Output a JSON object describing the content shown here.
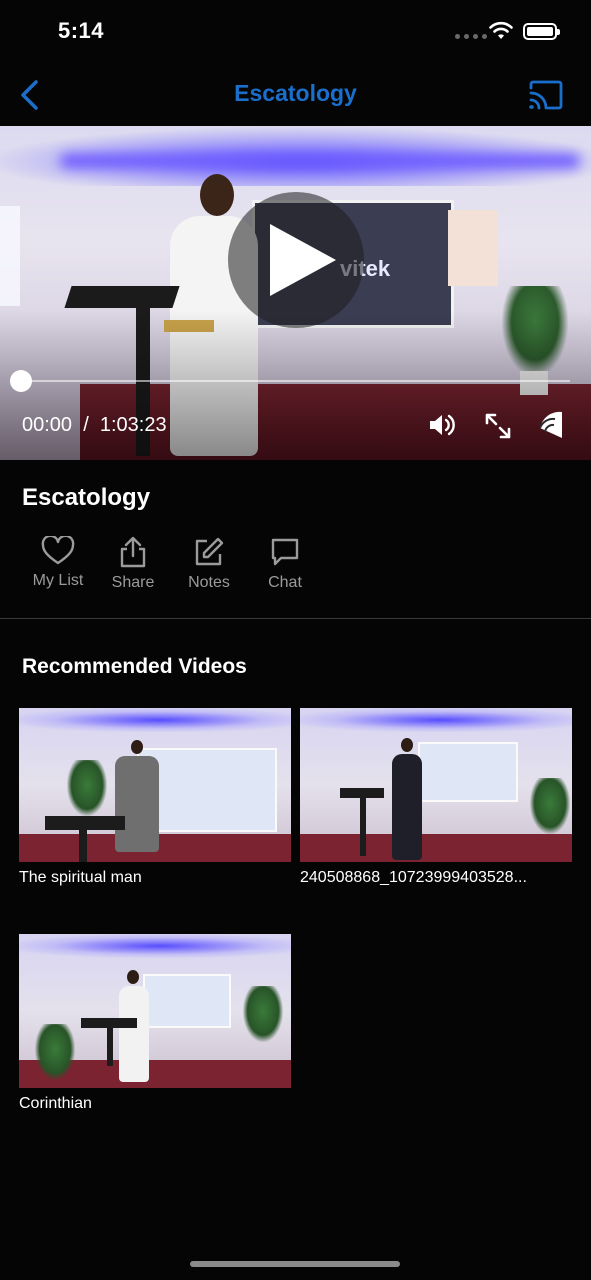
{
  "status_bar": {
    "time": "5:14"
  },
  "nav": {
    "title": "Escatology"
  },
  "player": {
    "current_time": "00:00",
    "separator": "/",
    "duration": "1:03:23",
    "progress": 0,
    "screen_text": "vitek"
  },
  "video": {
    "title": "Escatology"
  },
  "actions": [
    {
      "label": "My List",
      "icon": "heart-icon"
    },
    {
      "label": "Share",
      "icon": "share-icon"
    },
    {
      "label": "Notes",
      "icon": "edit-icon"
    },
    {
      "label": "Chat",
      "icon": "chat-bubble-icon"
    }
  ],
  "recommended": {
    "title": "Recommended Videos",
    "items": [
      {
        "title": "The spiritual man"
      },
      {
        "title": "240508868_10723999403528..."
      },
      {
        "title": "Corinthian"
      }
    ]
  },
  "colors": {
    "accent": "#1a6fcc",
    "background": "#050505",
    "muted": "#9b9b9b"
  }
}
